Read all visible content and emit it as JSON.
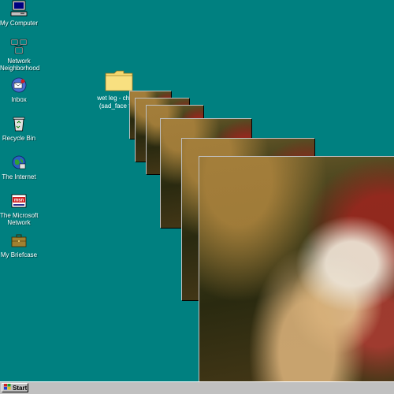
{
  "desktop": {
    "background_color": "#008080",
    "icons": [
      {
        "name": "my-computer-icon",
        "label": "My Computer"
      },
      {
        "name": "network-neighborhood-icon",
        "label_line1": "Network",
        "label_line2": "Neighborhood"
      },
      {
        "name": "inbox-icon",
        "label": "Inbox"
      },
      {
        "name": "recycle-bin-icon",
        "label": "Recycle Bin"
      },
      {
        "name": "the-internet-icon",
        "label": "The Internet"
      },
      {
        "name": "msn-icon",
        "label_line1": "The Microsoft",
        "label_line2": "Network"
      },
      {
        "name": "briefcase-icon",
        "label": "My Briefcase"
      }
    ],
    "folder": {
      "label_line1": "wet leg - chaise",
      "label_line2": "(sad_face file)"
    }
  },
  "taskbar": {
    "start_label": "Start"
  }
}
